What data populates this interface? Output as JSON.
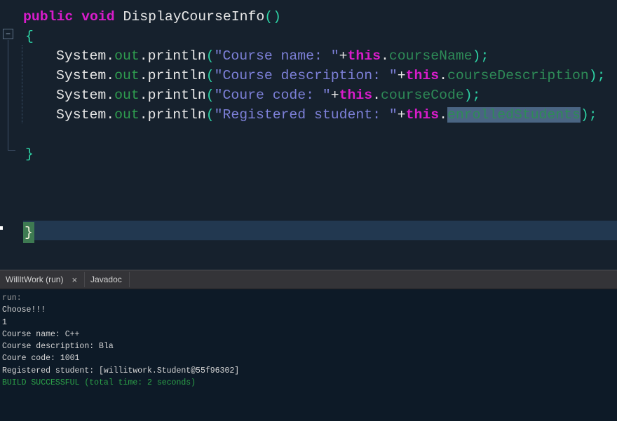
{
  "editor": {
    "background": "#16212d",
    "current_line_color": "#223850",
    "selection_color": "#4a6583",
    "brace_match_bg": "#3e7a52",
    "brace_match_fg": "#f2f2dc",
    "token_colors": {
      "keyword": "#d91ccb",
      "plain": "#e8e8e8",
      "out": "#2f9e4f",
      "string": "#7d80d8",
      "field": "#2e8b57",
      "paren": "#2ed3a5"
    },
    "lines": [
      {
        "x": 33,
        "tokens": [
          {
            "t": "public",
            "c": "keyword",
            "bold": true
          },
          {
            "t": " ",
            "c": "plain"
          },
          {
            "t": "void",
            "c": "keyword",
            "bold": true
          },
          {
            "t": " DisplayCourseInfo",
            "c": "plain"
          },
          {
            "t": "()",
            "c": "paren"
          }
        ]
      },
      {
        "x": 36,
        "tokens": [
          {
            "t": "{",
            "c": "paren"
          }
        ]
      },
      {
        "x": 80,
        "tokens": [
          {
            "t": "System",
            "c": "plain"
          },
          {
            "t": ".",
            "c": "plain"
          },
          {
            "t": "out",
            "c": "out"
          },
          {
            "t": ".",
            "c": "plain"
          },
          {
            "t": "println",
            "c": "plain"
          },
          {
            "t": "(",
            "c": "paren"
          },
          {
            "t": "\"Course name: \"",
            "c": "string"
          },
          {
            "t": "+",
            "c": "plain"
          },
          {
            "t": "this",
            "c": "keyword",
            "bold": true
          },
          {
            "t": ".",
            "c": "plain"
          },
          {
            "t": "courseName",
            "c": "field"
          },
          {
            "t": ");",
            "c": "paren"
          }
        ]
      },
      {
        "x": 80,
        "tokens": [
          {
            "t": "System",
            "c": "plain"
          },
          {
            "t": ".",
            "c": "plain"
          },
          {
            "t": "out",
            "c": "out"
          },
          {
            "t": ".",
            "c": "plain"
          },
          {
            "t": "println",
            "c": "plain"
          },
          {
            "t": "(",
            "c": "paren"
          },
          {
            "t": "\"Course description: \"",
            "c": "string"
          },
          {
            "t": "+",
            "c": "plain"
          },
          {
            "t": "this",
            "c": "keyword",
            "bold": true
          },
          {
            "t": ".",
            "c": "plain"
          },
          {
            "t": "courseDescription",
            "c": "field"
          },
          {
            "t": ");",
            "c": "paren"
          }
        ]
      },
      {
        "x": 80,
        "tokens": [
          {
            "t": "System",
            "c": "plain"
          },
          {
            "t": ".",
            "c": "plain"
          },
          {
            "t": "out",
            "c": "out"
          },
          {
            "t": ".",
            "c": "plain"
          },
          {
            "t": "println",
            "c": "plain"
          },
          {
            "t": "(",
            "c": "paren"
          },
          {
            "t": "\"Coure code: \"",
            "c": "string"
          },
          {
            "t": "+",
            "c": "plain"
          },
          {
            "t": "this",
            "c": "keyword",
            "bold": true
          },
          {
            "t": ".",
            "c": "plain"
          },
          {
            "t": "courseCode",
            "c": "field"
          },
          {
            "t": ");",
            "c": "paren"
          }
        ]
      },
      {
        "x": 80,
        "tokens": [
          {
            "t": "System",
            "c": "plain"
          },
          {
            "t": ".",
            "c": "plain"
          },
          {
            "t": "out",
            "c": "out"
          },
          {
            "t": ".",
            "c": "plain"
          },
          {
            "t": "println",
            "c": "plain"
          },
          {
            "t": "(",
            "c": "paren"
          },
          {
            "t": "\"Registered student: \"",
            "c": "string"
          },
          {
            "t": "+",
            "c": "plain"
          },
          {
            "t": "this",
            "c": "keyword",
            "bold": true
          },
          {
            "t": ".",
            "c": "plain"
          },
          {
            "t": "enrolledStudents",
            "c": "field",
            "sel": true
          },
          {
            "t": ");",
            "c": "paren"
          }
        ]
      },
      {
        "x": 80,
        "tokens": []
      },
      {
        "x": 36,
        "tokens": [
          {
            "t": "}",
            "c": "paren"
          }
        ]
      },
      {
        "x": 33,
        "tokens": []
      },
      {
        "x": 33,
        "tokens": []
      },
      {
        "x": 33,
        "tokens": []
      },
      {
        "x": 33,
        "current": true,
        "tokens": [
          {
            "t": "}",
            "c": "brace"
          }
        ]
      }
    ]
  },
  "output_panel": {
    "tabs": [
      {
        "label": "WillItWork (run)",
        "closable": true,
        "selected": true
      },
      {
        "label": "Javadoc",
        "closable": false,
        "selected": false
      }
    ],
    "console": {
      "background": "#0d1a27",
      "colors": {
        "muted": "#9a9a9a",
        "normal": "#d6d6d6",
        "success": "#2ca349"
      },
      "lines": [
        {
          "t": "run:",
          "c": "muted"
        },
        {
          "t": "Choose!!!",
          "c": "normal"
        },
        {
          "t": "1",
          "c": "normal"
        },
        {
          "t": "Course name: C++",
          "c": "normal"
        },
        {
          "t": "Course description: Bla",
          "c": "normal"
        },
        {
          "t": "Coure code: 1001",
          "c": "normal"
        },
        {
          "t": "Registered student: [willitwork.Student@55f96302]",
          "c": "normal"
        },
        {
          "t": "BUILD SUCCESSFUL (total time: 2 seconds)",
          "c": "success"
        }
      ]
    }
  },
  "icons": {
    "close": "×",
    "fold_collapse": "−"
  }
}
